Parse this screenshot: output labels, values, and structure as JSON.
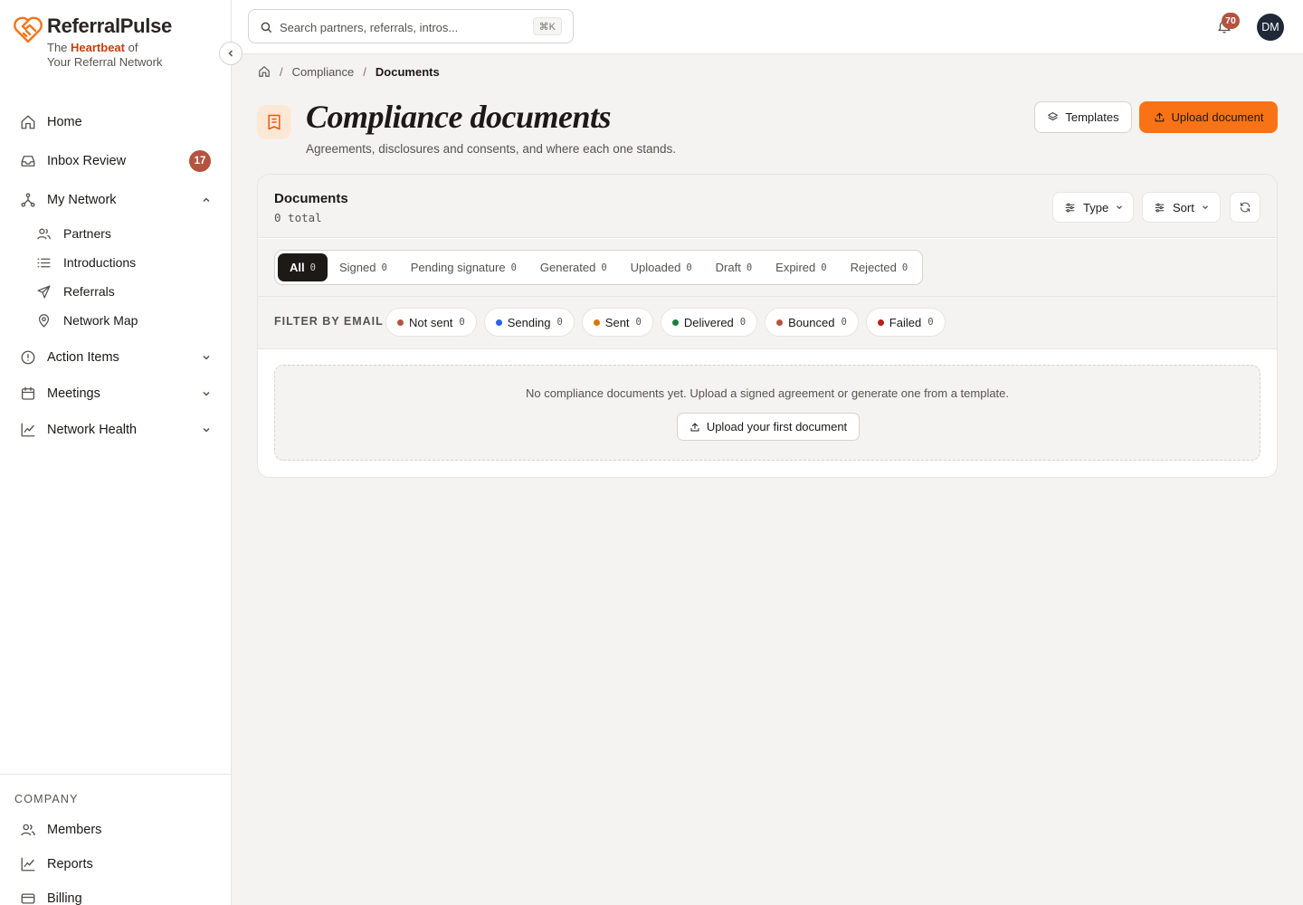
{
  "brand": {
    "name": "ReferralPulse",
    "tagline_pre": "The ",
    "tagline_em": "Heartbeat",
    "tagline_post": " of",
    "tagline_line2": "Your Referral Network",
    "accent": "#f97316"
  },
  "sidebar": {
    "home": "Home",
    "inbox": {
      "label": "Inbox Review",
      "count": "17"
    },
    "network": {
      "label": "My Network",
      "children": [
        "Partners",
        "Introductions",
        "Referrals",
        "Network Map"
      ]
    },
    "action_items": "Action Items",
    "meetings": "Meetings",
    "network_health": "Network Health",
    "company": {
      "heading": "COMPANY",
      "items": [
        "Members",
        "Reports",
        "Billing"
      ]
    }
  },
  "topbar": {
    "search_placeholder": "Search partners, referrals, intros...",
    "shortcut": "⌘K",
    "notifications": "70",
    "avatar_initials": "DM"
  },
  "breadcrumb": {
    "parent": "Compliance",
    "current": "Documents"
  },
  "page": {
    "title": "Compliance documents",
    "subtitle": "Agreements, disclosures and consents, and where each one stands.",
    "templates_label": "Templates",
    "upload_label": "Upload document"
  },
  "card": {
    "title": "Documents",
    "count": "0 total",
    "type_label": "Type",
    "sort_label": "Sort",
    "tabs": [
      {
        "label": "All",
        "count": "0"
      },
      {
        "label": "Signed",
        "count": "0"
      },
      {
        "label": "Pending signature",
        "count": "0"
      },
      {
        "label": "Generated",
        "count": "0"
      },
      {
        "label": "Uploaded",
        "count": "0"
      },
      {
        "label": "Draft",
        "count": "0"
      },
      {
        "label": "Expired",
        "count": "0"
      },
      {
        "label": "Rejected",
        "count": "0"
      }
    ],
    "filter_label": "FILTER BY EMAIL",
    "email_filters": [
      {
        "label": "Not sent",
        "count": "0",
        "color": "#b4533f"
      },
      {
        "label": "Sending",
        "count": "0",
        "color": "#2563eb"
      },
      {
        "label": "Sent",
        "count": "0",
        "color": "#d97706"
      },
      {
        "label": "Delivered",
        "count": "0",
        "color": "#15803d"
      },
      {
        "label": "Bounced",
        "count": "0",
        "color": "#b4533f"
      },
      {
        "label": "Failed",
        "count": "0",
        "color": "#b91c1c"
      }
    ],
    "empty_text": "No compliance documents yet. Upload a signed agreement or generate one from a template.",
    "empty_button": "Upload your first document"
  }
}
